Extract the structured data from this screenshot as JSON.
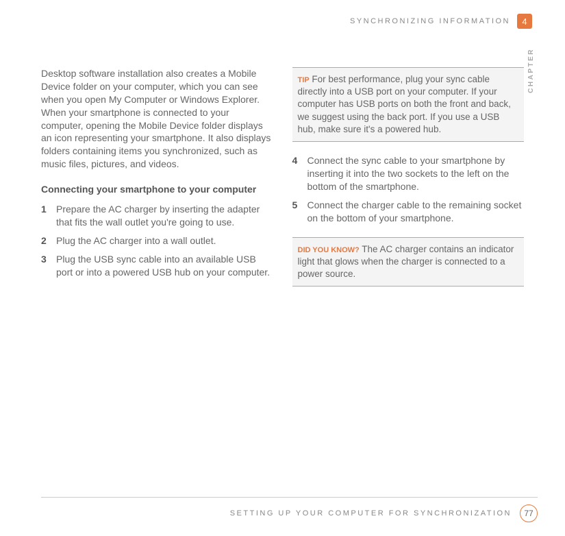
{
  "header": {
    "section": "SYNCHRONIZING INFORMATION",
    "chapter_num": "4",
    "side_label": "CHAPTER"
  },
  "left": {
    "intro": "Desktop software installation also creates a Mobile Device folder on your computer, which you can see when you open My Computer or Windows Explorer. When your smartphone is connected to your computer, opening the Mobile Device folder displays an icon representing your smartphone. It also displays folders containing items you synchronized, such as music files, pictures, and videos.",
    "subhead": "Connecting your smartphone to your computer",
    "steps": {
      "n1": "1",
      "t1": "Prepare the AC charger by inserting the adapter that fits the wall outlet you're going to use.",
      "n2": "2",
      "t2": "Plug the AC charger into a wall outlet.",
      "n3": "3",
      "t3": "Plug the USB sync cable into an available USB port or into a powered USB hub on your computer."
    }
  },
  "right": {
    "tip_label": "TIP",
    "tip_text": "For best performance, plug your sync cable directly into a USB port on your computer. If your computer has USB ports on both the front and back, we suggest using the back port. If you use a USB hub, make sure it's a powered hub.",
    "steps": {
      "n4": "4",
      "t4": "Connect the sync cable to your smartphone by inserting it into the two sockets to the left on the bottom of the smartphone.",
      "n5": "5",
      "t5": "Connect the charger cable to the remaining socket on the bottom of your smartphone."
    },
    "dyk_label": "DID YOU KNOW?",
    "dyk_text": "The AC charger contains an indicator light that glows when the charger is connected to a power source."
  },
  "footer": {
    "title": "SETTING UP YOUR COMPUTER FOR SYNCHRONIZATION",
    "page": "77"
  }
}
